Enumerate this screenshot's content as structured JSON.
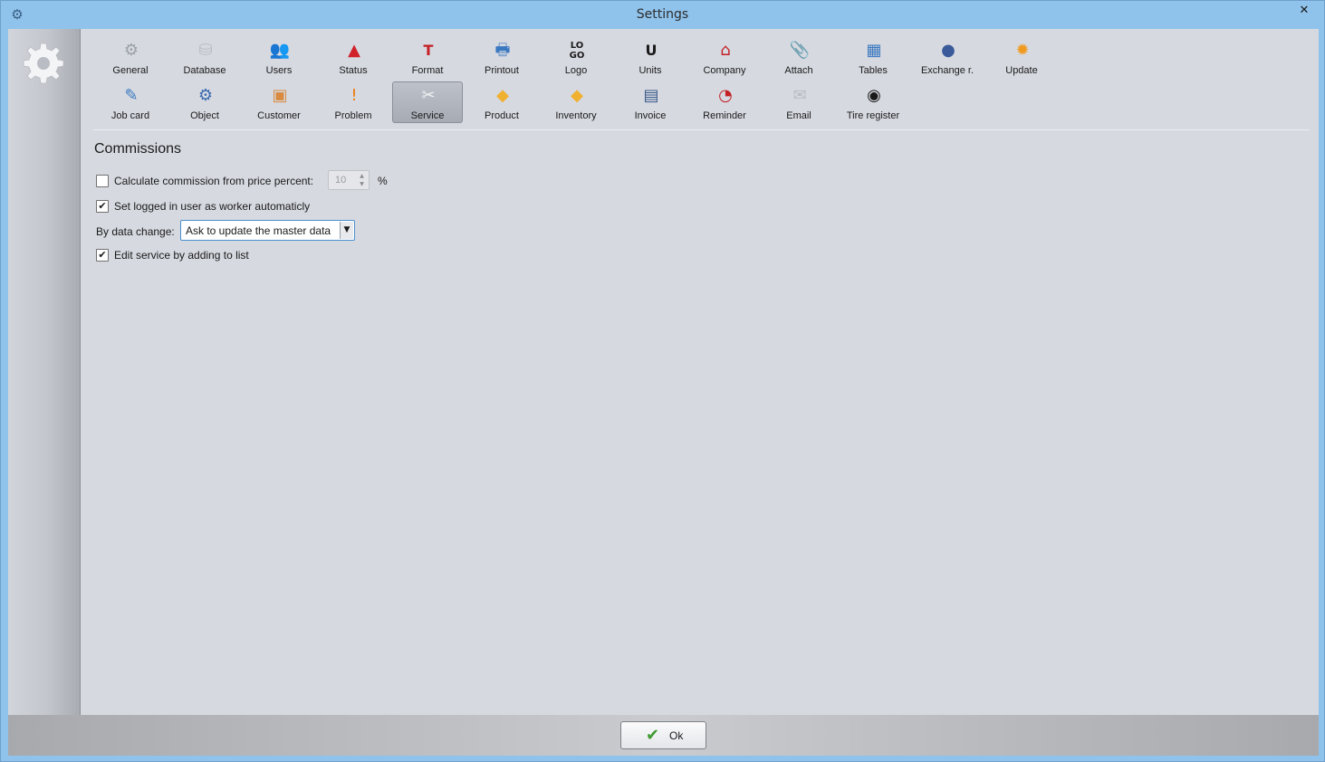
{
  "window": {
    "title": "Settings",
    "close_glyph": "✕",
    "icon_glyph": "⚙"
  },
  "toolbar": {
    "active": "Service",
    "items": [
      {
        "label": "General",
        "icon": "gear-icon",
        "glyph": "⚙",
        "color": "#9aa0a8"
      },
      {
        "label": "Database",
        "icon": "database-icon",
        "glyph": "⛁",
        "color": "#b8bcc2"
      },
      {
        "label": "Users",
        "icon": "users-icon",
        "glyph": "👥",
        "color": "#d86a2e"
      },
      {
        "label": "Status",
        "icon": "warning-triangle-icon",
        "glyph": "▲",
        "color": "#d0202a"
      },
      {
        "label": "Format",
        "icon": "format-icon",
        "glyph": "T",
        "color": "#c42026"
      },
      {
        "label": "Printout",
        "icon": "printer-icon",
        "glyph": "🖶",
        "color": "#3a78c0"
      },
      {
        "label": "Logo",
        "icon": "logo-icon",
        "glyph": "LO GO",
        "color": "#1a1a1a"
      },
      {
        "label": "Units",
        "icon": "units-icon",
        "glyph": "U",
        "color": "#1a1a1a"
      },
      {
        "label": "Company",
        "icon": "house-icon",
        "glyph": "⌂",
        "color": "#c42026"
      },
      {
        "label": "Attach",
        "icon": "paperclip-icon",
        "glyph": "📎",
        "color": "#9aa0a8"
      },
      {
        "label": "Tables",
        "icon": "table-icon",
        "glyph": "▦",
        "color": "#3a78c0"
      },
      {
        "label": "Exchange r.",
        "icon": "currency-exchange-icon",
        "glyph": "●",
        "color": "#3a5a9a"
      },
      {
        "label": "Update",
        "icon": "update-icon",
        "glyph": "✹",
        "color": "#f09a20"
      },
      {
        "label": "Job card",
        "icon": "job-card-icon",
        "glyph": "✎",
        "color": "#3a78c0"
      },
      {
        "label": "Object",
        "icon": "object-gear-icon",
        "glyph": "⚙",
        "color": "#3a6ab0"
      },
      {
        "label": "Customer",
        "icon": "customer-icon",
        "glyph": "▣",
        "color": "#d88a40"
      },
      {
        "label": "Problem",
        "icon": "problem-icon",
        "glyph": "!",
        "color": "#f07a10"
      },
      {
        "label": "Service",
        "icon": "wrench-screwdriver-icon",
        "glyph": "✂",
        "color": "#f2f2f2"
      },
      {
        "label": "Product",
        "icon": "product-box-icon",
        "glyph": "◆",
        "color": "#f0b030"
      },
      {
        "label": "Inventory",
        "icon": "inventory-boxes-icon",
        "glyph": "◆",
        "color": "#f0b030"
      },
      {
        "label": "Invoice",
        "icon": "invoice-icon",
        "glyph": "▤",
        "color": "#3a5a8a"
      },
      {
        "label": "Reminder",
        "icon": "reminder-clock-icon",
        "glyph": "◔",
        "color": "#c42026"
      },
      {
        "label": "Email",
        "icon": "envelope-icon",
        "glyph": "✉",
        "color": "#b8bcc2"
      },
      {
        "label": "Tire register",
        "icon": "tire-icon",
        "glyph": "◉",
        "color": "#1a1a1a"
      }
    ]
  },
  "content": {
    "section_title": "Commissions",
    "calc_commission": {
      "label": "Calculate commission from price percent:",
      "checked": false,
      "value": "10",
      "unit": "%"
    },
    "set_logged_in": {
      "label": "Set logged in user as worker automaticly",
      "checked": true
    },
    "data_change": {
      "label": "By data change:",
      "selected": "Ask to update the master data"
    },
    "edit_service": {
      "label": "Edit service by adding to list",
      "checked": true
    }
  },
  "footer": {
    "ok_label": "Ok"
  }
}
